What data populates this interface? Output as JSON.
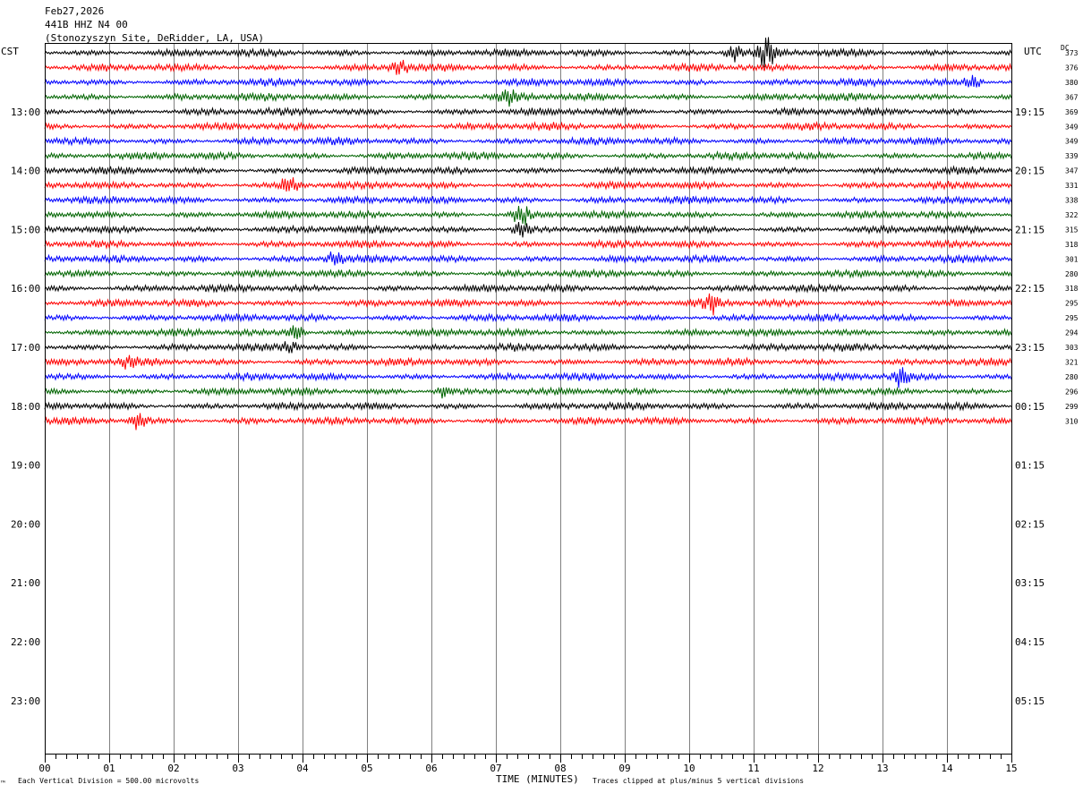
{
  "header": {
    "date": "Feb27,2026",
    "channel": "441B HHZ N4 00",
    "site": "(Stonozyszyn Site, DeRidder, LA, USA)"
  },
  "left_tz": "CST",
  "right_tz": "UTC",
  "dc_label": "DC",
  "footer": {
    "scale_note": "Each Vertical Division =  500.00 microvolts",
    "xlabel": "TIME (MINUTES)",
    "clip_note": "Traces clipped at plus/minus 5 vertical divisions",
    "corner_mark": "™"
  },
  "colors": {
    "trace_cycle": [
      "#000000",
      "#ff0000",
      "#0000ff",
      "#006400"
    ],
    "grid": "#808080",
    "frame": "#000000"
  },
  "chart_data": {
    "type": "line",
    "title": "441B HHZ N4 00",
    "xlabel": "TIME (MINUTES)",
    "x_ticks": [
      "00",
      "01",
      "02",
      "03",
      "04",
      "05",
      "06",
      "07",
      "08",
      "09",
      "10",
      "11",
      "12",
      "13",
      "14",
      "15"
    ],
    "xlim": [
      0,
      15
    ],
    "left_hour_labels": [
      "13:00",
      "14:00",
      "15:00",
      "16:00",
      "17:00",
      "18:00",
      "19:00",
      "20:00",
      "21:00",
      "22:00",
      "23:00"
    ],
    "right_hour_labels": [
      "19:15",
      "20:15",
      "21:15",
      "22:15",
      "23:15",
      "00:15",
      "01:15",
      "02:15",
      "03:15",
      "04:15",
      "05:15"
    ],
    "rows_total": 48,
    "rows_drawn": 26,
    "dc_offsets": [
      373,
      376,
      380,
      367,
      369,
      349,
      349,
      339,
      347,
      331,
      338,
      322,
      315,
      318,
      301,
      280,
      318,
      295,
      295,
      294,
      303,
      321,
      280,
      296,
      299,
      310
    ],
    "events": [
      {
        "row": 0,
        "minute": 11.2,
        "amp": 3.2
      },
      {
        "row": 0,
        "minute": 10.7,
        "amp": 1.6
      },
      {
        "row": 1,
        "minute": 5.5,
        "amp": 1.4
      },
      {
        "row": 2,
        "minute": 14.4,
        "amp": 1.5
      },
      {
        "row": 3,
        "minute": 7.2,
        "amp": 1.4
      },
      {
        "row": 9,
        "minute": 3.8,
        "amp": 1.7
      },
      {
        "row": 11,
        "minute": 7.4,
        "amp": 2.2
      },
      {
        "row": 12,
        "minute": 7.4,
        "amp": 1.5
      },
      {
        "row": 14,
        "minute": 4.5,
        "amp": 1.4
      },
      {
        "row": 17,
        "minute": 10.35,
        "amp": 1.8
      },
      {
        "row": 19,
        "minute": 3.9,
        "amp": 1.5
      },
      {
        "row": 20,
        "minute": 3.8,
        "amp": 1.3
      },
      {
        "row": 21,
        "minute": 1.3,
        "amp": 1.2
      },
      {
        "row": 22,
        "minute": 13.3,
        "amp": 2.0
      },
      {
        "row": 23,
        "minute": 6.2,
        "amp": 1.2
      },
      {
        "row": 25,
        "minute": 1.45,
        "amp": 1.5
      }
    ],
    "grid": true
  }
}
